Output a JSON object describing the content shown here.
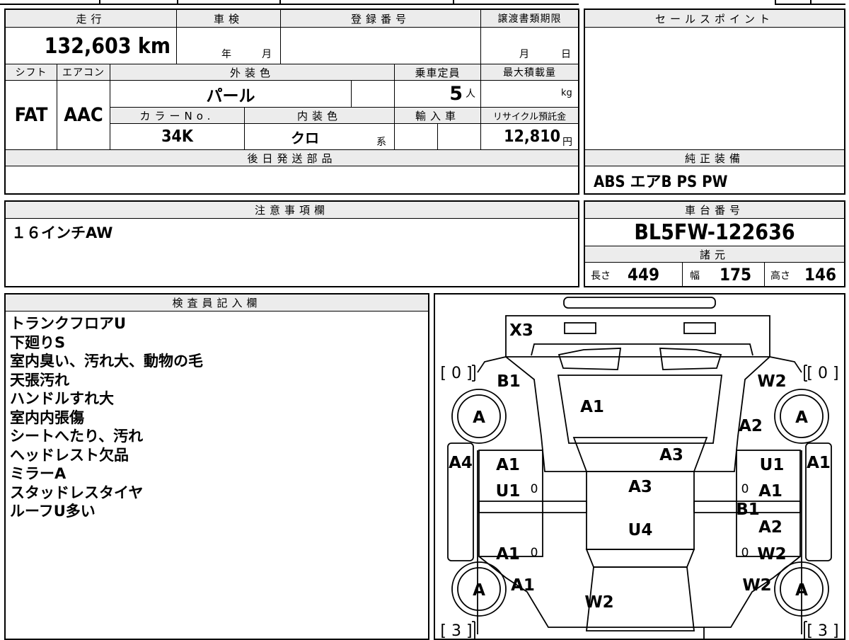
{
  "row1": {
    "mileage_label": "走行",
    "mileage": "132,603 km",
    "inspection_label": "車検",
    "year_unit": "年",
    "month_unit": "月",
    "reg_label": "登録番号",
    "transfer_label": "譲渡書類期限",
    "month": "月",
    "day": "日"
  },
  "row2": {
    "shift_label": "シフト",
    "ac_label": "エアコン",
    "exterior_label": "外装色",
    "capacity_label": "乗車定員",
    "maxload_label": "最大積載量",
    "shift": "FAT",
    "ac": "AAC",
    "exterior": "パール",
    "capacity": "5",
    "capacity_unit": "人",
    "load_unit": "kg"
  },
  "row3": {
    "color_no_label": "カラーNo.",
    "interior_label": "内装色",
    "import_label": "輸入車",
    "recycle_label": "リサイクル預託金",
    "color_no": "34K",
    "interior": "クロ",
    "interior_unit": "系",
    "recycle": "12,810",
    "recycle_unit": "円"
  },
  "later_parts_label": "後日発送部品",
  "sales_point_label": "セールスポイント",
  "equipment": {
    "label": "純正装備",
    "value": "ABS エアB PS PW"
  },
  "caution": {
    "label": "注意事項欄",
    "value": "１６インチAW"
  },
  "chassis": {
    "label": "車台番号",
    "value": "BL5FW-122636"
  },
  "specs": {
    "label": "諸元",
    "length_label": "長さ",
    "length": "449",
    "width_label": "幅",
    "width": "175",
    "height_label": "高さ",
    "height": "146"
  },
  "inspector": {
    "label": "検査員記入欄",
    "notes": [
      "トランクフロアU",
      "下廻りS",
      "室内臭い、汚れ大、動物の毛",
      "天張汚れ",
      "ハンドルすれ大",
      "室内内張傷",
      "シートへたり、汚れ",
      "ヘッドレスト欠品",
      "ミラーA",
      "スタッドレスタイヤ",
      "ルーフU多い"
    ]
  },
  "diagram": {
    "tread_fl": "[ 0 ]",
    "tread_fr": "[ 0 ]",
    "tread_rl": "[ 3 ]",
    "tread_rr": "[ 3 ]",
    "wheel": "A",
    "zero": "0",
    "marks": {
      "trunk": "X3",
      "rear_left_fender": "B1",
      "rear_right_fender": "W2",
      "rear_right_fender2": "A2",
      "rear_glass": "A1",
      "roof": "A3",
      "cabin": "A3",
      "cabin_mid": "U4",
      "left_rear_door": "A1",
      "left_rear_door2": "U1",
      "left_front_door": "A1",
      "right_rear_door": "U1",
      "right_rear_door2": "A1",
      "right_pillar": "B1",
      "right_front_door": "A2",
      "right_front_door2": "W2",
      "left_side": "A4",
      "right_side": "A1",
      "front_left_fender": "A1",
      "front_right_fender": "W2",
      "hood": "W2"
    }
  }
}
